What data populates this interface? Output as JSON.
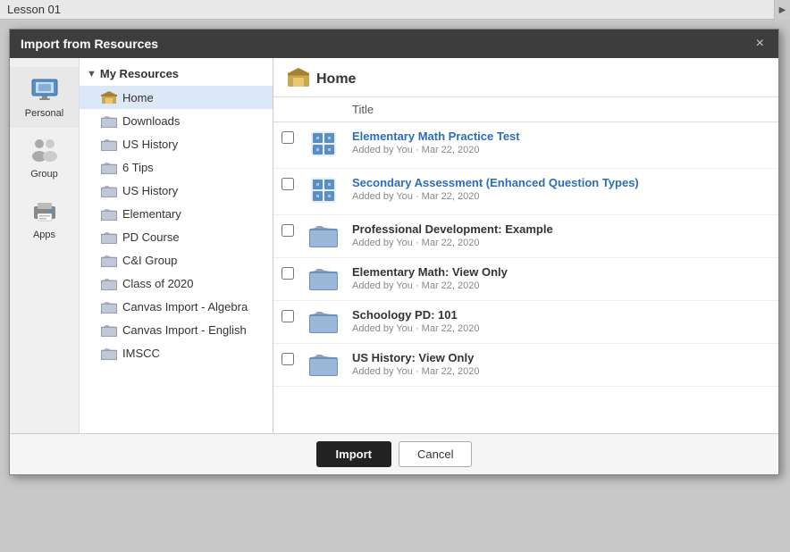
{
  "lesson_bar": {
    "title": "Lesson 01"
  },
  "modal": {
    "title": "Import from Resources",
    "close_label": "×"
  },
  "icon_sidebar": {
    "items": [
      {
        "id": "personal",
        "label": "Personal",
        "active": true
      },
      {
        "id": "group",
        "label": "Group",
        "active": false
      },
      {
        "id": "apps",
        "label": "Apps",
        "active": false
      }
    ]
  },
  "tree": {
    "root_label": "My Resources",
    "items": [
      {
        "id": "home",
        "label": "Home",
        "type": "home",
        "active": true
      },
      {
        "id": "downloads",
        "label": "Downloads",
        "type": "folder"
      },
      {
        "id": "us-history-1",
        "label": "US History",
        "type": "folder"
      },
      {
        "id": "6-tips",
        "label": "6 Tips",
        "type": "folder"
      },
      {
        "id": "us-history-2",
        "label": "US History",
        "type": "folder"
      },
      {
        "id": "elementary",
        "label": "Elementary",
        "type": "folder"
      },
      {
        "id": "pd-course",
        "label": "PD Course",
        "type": "folder"
      },
      {
        "id": "ci-group",
        "label": "C&I Group",
        "type": "folder"
      },
      {
        "id": "class-2020",
        "label": "Class of 2020",
        "type": "folder"
      },
      {
        "id": "canvas-algebra",
        "label": "Canvas Import - Algebra",
        "type": "folder"
      },
      {
        "id": "canvas-english",
        "label": "Canvas Import - English",
        "type": "folder"
      },
      {
        "id": "imscc",
        "label": "IMSCC",
        "type": "folder"
      }
    ]
  },
  "content": {
    "header": "Home",
    "column_title": "Title",
    "resources": [
      {
        "id": "r1",
        "title": "Elementary Math Practice Test",
        "meta": "Added by You · Mar 22, 2020",
        "type": "puzzle",
        "checked": false
      },
      {
        "id": "r2",
        "title": "Secondary Assessment (Enhanced Question Types)",
        "meta": "Added by You · Mar 22, 2020",
        "type": "puzzle",
        "checked": false
      },
      {
        "id": "r3",
        "title": "Professional Development: Example",
        "meta": "Added by You · Mar 22, 2020",
        "type": "folder",
        "checked": false
      },
      {
        "id": "r4",
        "title": "Elementary Math: View Only",
        "meta": "Added by You · Mar 22, 2020",
        "type": "folder",
        "checked": false
      },
      {
        "id": "r5",
        "title": "Schoology PD: 101",
        "meta": "Added by You · Mar 22, 2020",
        "type": "folder",
        "checked": false
      },
      {
        "id": "r6",
        "title": "US History: View Only",
        "meta": "Added by You · Mar 22, 2020",
        "type": "folder",
        "checked": false
      }
    ]
  },
  "footer": {
    "import_label": "Import",
    "cancel_label": "Cancel"
  },
  "colors": {
    "accent_blue": "#2a6ebb",
    "header_bg": "#3d3d3d",
    "active_row": "#dce8f8"
  }
}
